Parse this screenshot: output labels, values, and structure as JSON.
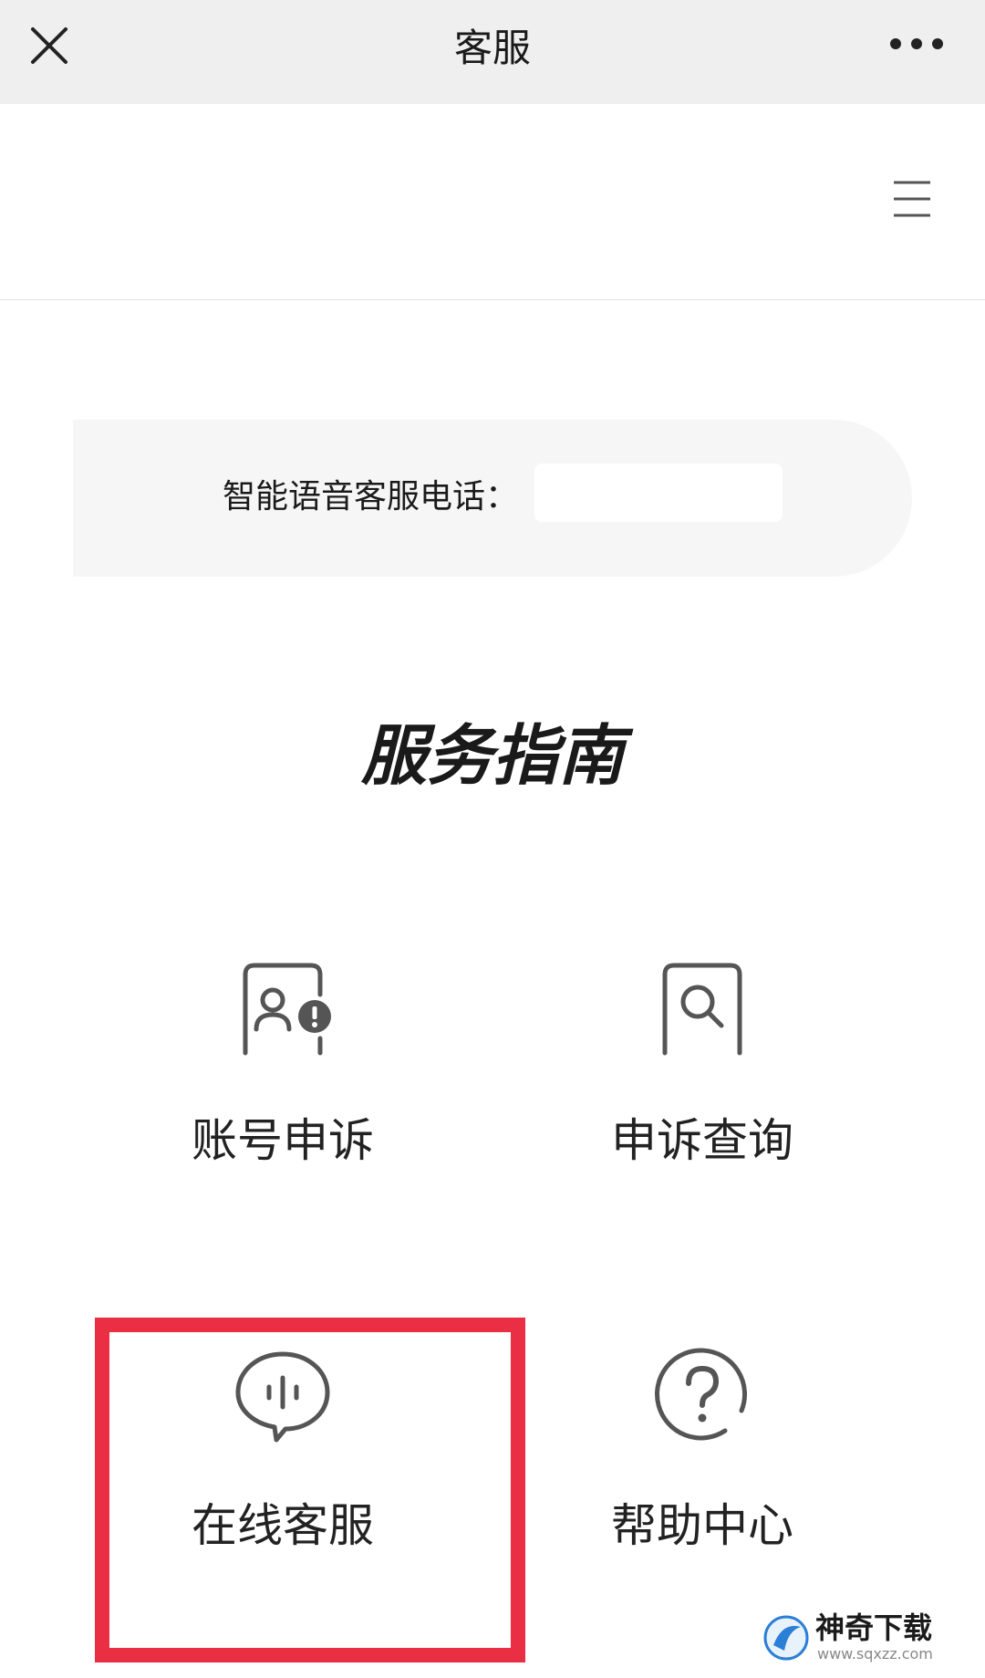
{
  "top_bar": {
    "title": "客服",
    "close_icon": "close-icon",
    "more_icon": "more-dots-icon"
  },
  "menu_row": {
    "menu_icon": "hamburger-menu-icon"
  },
  "hotline": {
    "label": "智能语音客服电话：",
    "number": ""
  },
  "service_guide": {
    "title": "服务指南",
    "items": [
      {
        "label": "账号申诉",
        "icon": "account-appeal-icon"
      },
      {
        "label": "申诉查询",
        "icon": "appeal-search-icon"
      },
      {
        "label": "在线客服",
        "icon": "chat-bubble-icon"
      },
      {
        "label": "帮助中心",
        "icon": "help-question-icon"
      }
    ]
  },
  "highlight": {
    "color": "#ea2f45",
    "target": "在线客服"
  },
  "watermark": {
    "title": "神奇下载",
    "url": "www.sqxzz.com"
  },
  "colors": {
    "top_bar_bg": "#efefef",
    "icon_stroke": "#555555",
    "highlight": "#ea2f45"
  }
}
